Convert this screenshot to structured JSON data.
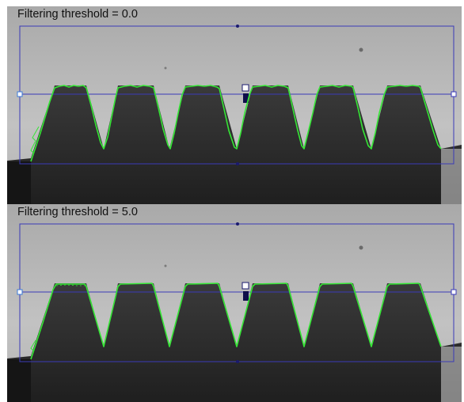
{
  "panels": [
    {
      "caption": "Filtering threshold = 0.0"
    },
    {
      "caption": "Filtering threshold = 5.0"
    }
  ],
  "colors": {
    "roi_box": "#3a3ab8",
    "edge_line": "#35e635",
    "handle": "#1a1a6e",
    "background_gray": "#b9b9b9",
    "dark_part": "#2b2b2b"
  }
}
